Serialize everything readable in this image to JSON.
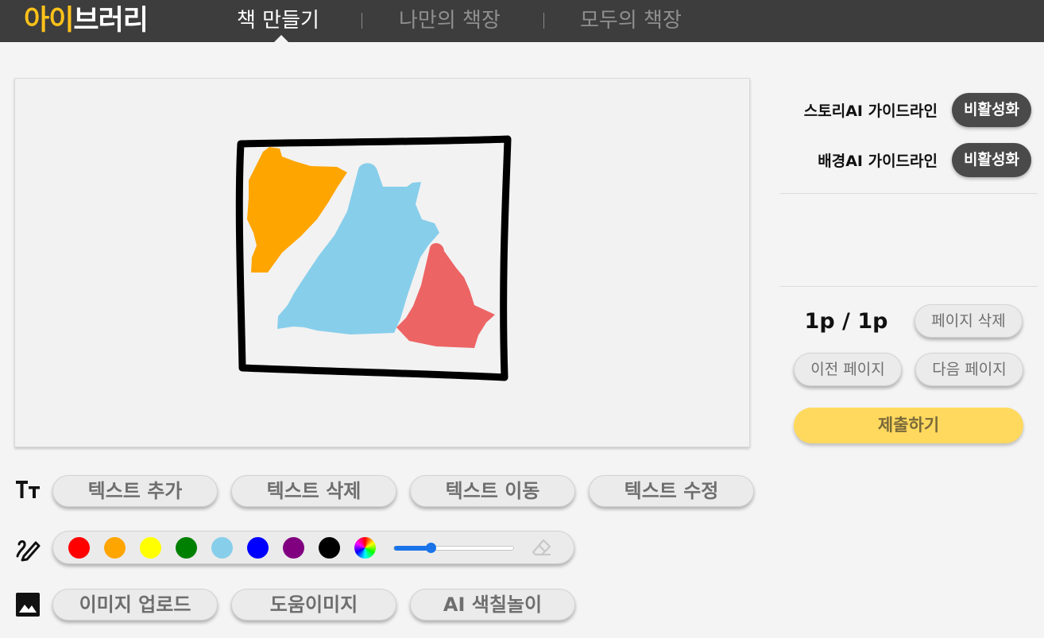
{
  "header": {
    "logo_accent": "아이",
    "logo_rest": "브러리",
    "nav": [
      {
        "label": "책 만들기",
        "active": true
      },
      {
        "label": "나만의 책장",
        "active": false
      },
      {
        "label": "모두의 책장",
        "active": false
      }
    ]
  },
  "canvas": {
    "stroke_color": "#000000",
    "shape_colors": {
      "orange": "#ffa500",
      "sky_blue": "#87ceeb",
      "red": "#ed6464"
    }
  },
  "text_tools": {
    "icon": "text-size-icon",
    "buttons": [
      "텍스트 추가",
      "텍스트 삭제",
      "텍스트 이동",
      "텍스트 수정"
    ]
  },
  "draw_tools": {
    "icon": "pen-icon",
    "colors": [
      "#ff0000",
      "#ffa500",
      "#ffff00",
      "#008000",
      "#87ceeb",
      "#0000ff",
      "#800080",
      "#000000"
    ],
    "custom_color_icon": "color-wheel-icon",
    "brush_size_fraction": 0.3,
    "eraser_icon": "eraser-icon"
  },
  "image_tools": {
    "icon": "image-icon",
    "buttons": [
      "이미지 업로드",
      "도움이미지",
      "AI 색칠놀이"
    ]
  },
  "side_panel": {
    "story_ai_label": "스토리AI 가이드라인",
    "story_ai_toggle": "비활성화",
    "background_ai_label": "배경AI 가이드라인",
    "background_ai_toggle": "비활성화",
    "page_indicator": "1p / 1p",
    "delete_page": "페이지 삭제",
    "prev_page": "이전 페이지",
    "next_page": "다음 페이지",
    "submit": "제출하기"
  },
  "colors": {
    "header_bg": "#3d3d3d",
    "logo_accent": "#ffc21a",
    "toggle_bg": "#4a4a4a",
    "submit_bg": "#ffd95e"
  }
}
